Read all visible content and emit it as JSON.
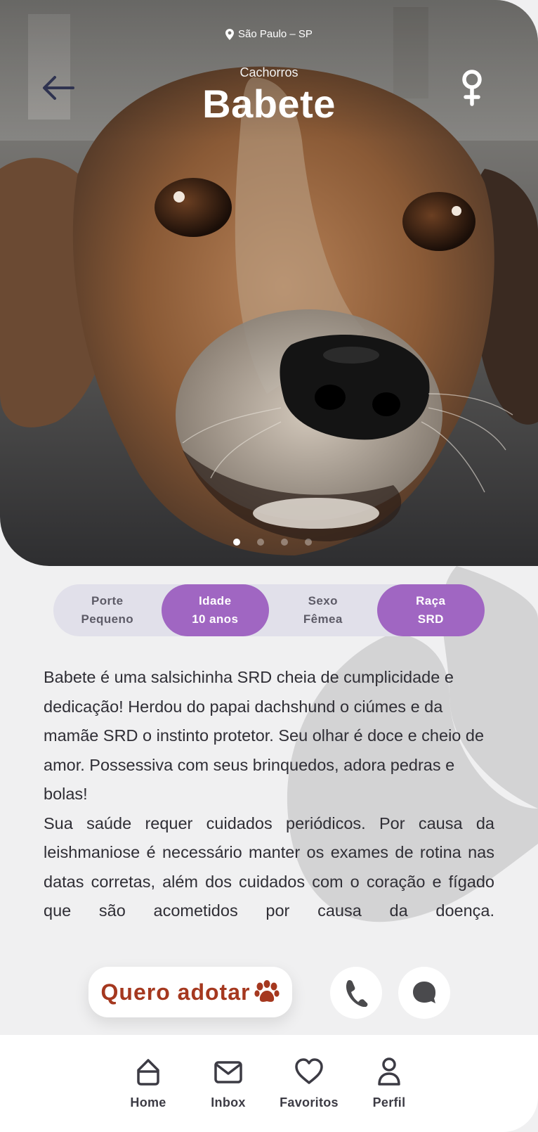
{
  "hero": {
    "location": "São Paulo – SP",
    "category": "Cachorros",
    "name": "Babete",
    "photo": "dog-photo",
    "carousel": {
      "count": 4,
      "active": 0
    }
  },
  "attributes": [
    {
      "label": "Porte",
      "value": "Pequeno",
      "highlighted": false
    },
    {
      "label": "Idade",
      "value": "10 anos",
      "highlighted": true
    },
    {
      "label": "Sexo",
      "value": "Fêmea",
      "highlighted": false
    },
    {
      "label": "Raça",
      "value": "SRD",
      "highlighted": true
    }
  ],
  "description": {
    "paragraph1": "Babete é uma salsichinha SRD cheia de cumplicidade e dedicação! Herdou do papai dachshund o ciúmes e da mamãe SRD o instinto protetor. Seu olhar é doce e cheio de amor. Possessiva com seus brinquedos, adora pedras e bolas!",
    "paragraph2": "Sua saúde requer cuidados periódicos. Por causa da leishmaniose é necessário manter os exames de rotina nas datas corretas, além dos cuidados com o coração e fígado que são acometidos por causa da doença."
  },
  "actions": {
    "adopt_label": "Quero adotar",
    "adopt_icon": "paw-icon",
    "call_icon": "phone-icon",
    "chat_icon": "chat-icon"
  },
  "nav": {
    "home": "Home",
    "inbox": "Inbox",
    "favorites": "Favoritos",
    "profile": "Perfil"
  },
  "colors": {
    "accent": "#a066c2",
    "adopt_text": "#a5381f",
    "background": "#f0f0f1",
    "pill": "#e1e0ea"
  }
}
